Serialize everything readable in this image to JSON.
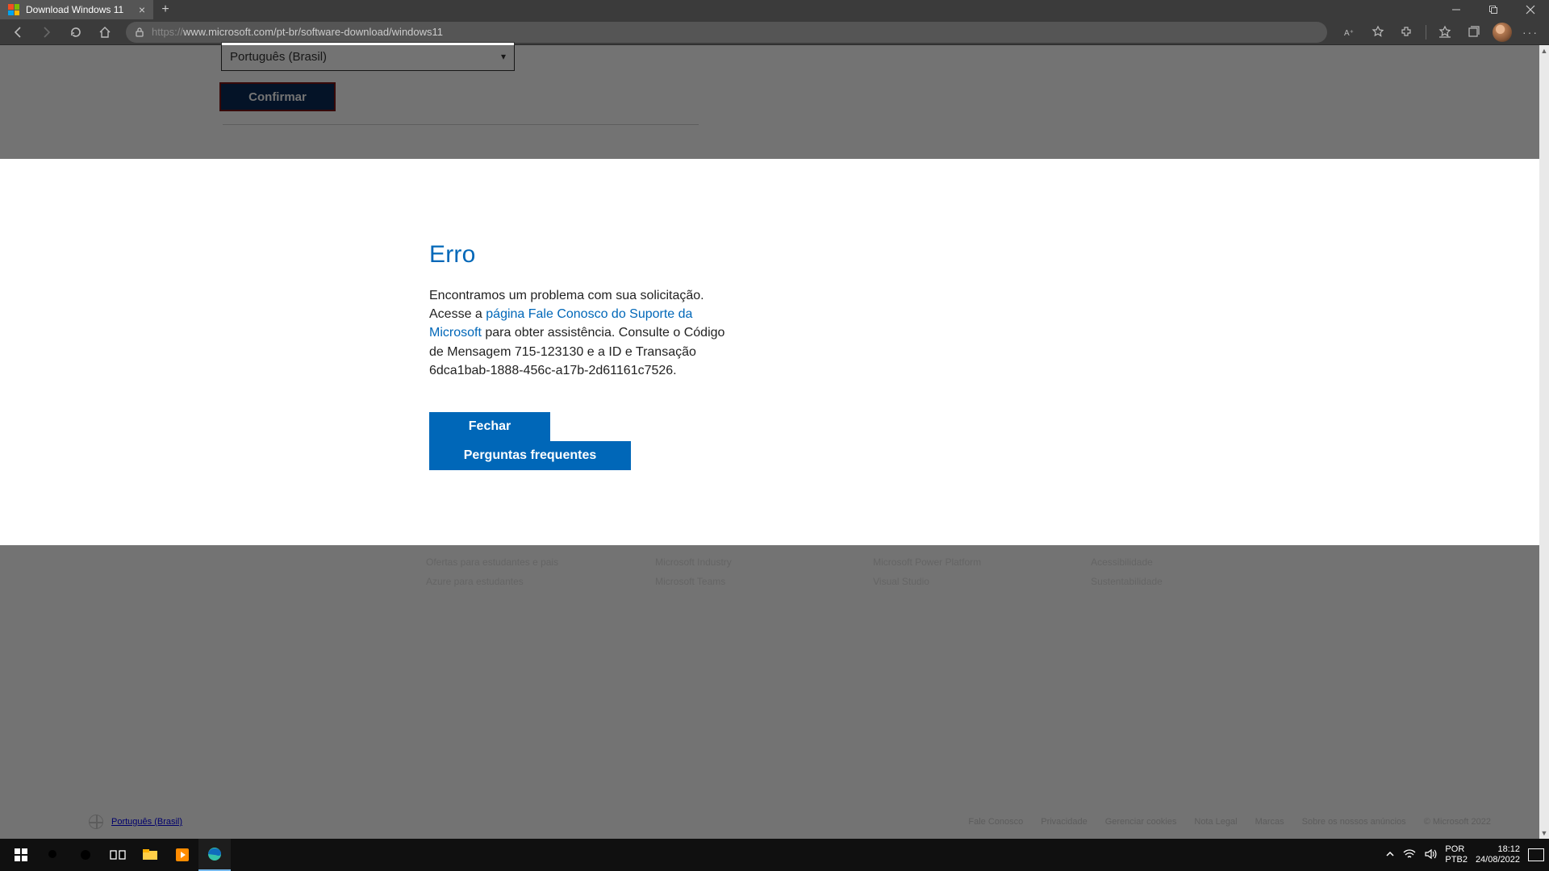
{
  "browser": {
    "tab_title": "Download Windows 11",
    "url_proto": "https://",
    "url_rest": "www.microsoft.com/pt-br/software-download/windows11"
  },
  "page": {
    "language_select": "Português (Brasil)",
    "confirm_label": "Confirmar"
  },
  "error": {
    "title": "Erro",
    "text_before_link": "Encontramos um problema com sua solicitação. Acesse a ",
    "link_text": "página Fale Conosco do Suporte da Microsoft",
    "text_after_link": " para obter assistência. Consulte o Código de Mensagem 715-123130 e a ID e Transação 6dca1bab-1888-456c-a17b-2d61161c7526.",
    "close_label": "Fechar",
    "faq_label": "Perguntas frequentes"
  },
  "footer": {
    "cols": [
      [
        "Ofertas para estudantes e pais",
        "Azure para estudantes"
      ],
      [
        "Microsoft Industry",
        "Microsoft Teams"
      ],
      [
        "Microsoft Power Platform",
        "Visual Studio"
      ],
      [
        "Acessibilidade",
        "Sustentabilidade"
      ]
    ],
    "locale": "Português (Brasil)",
    "links": [
      "Fale Conosco",
      "Privacidade",
      "Gerenciar cookies",
      "Nota Legal",
      "Marcas",
      "Sobre os nossos anúncios",
      "© Microsoft 2022"
    ]
  },
  "tray": {
    "ime1": "POR",
    "ime2": "PTB2",
    "time": "18:12",
    "date": "24/08/2022"
  }
}
